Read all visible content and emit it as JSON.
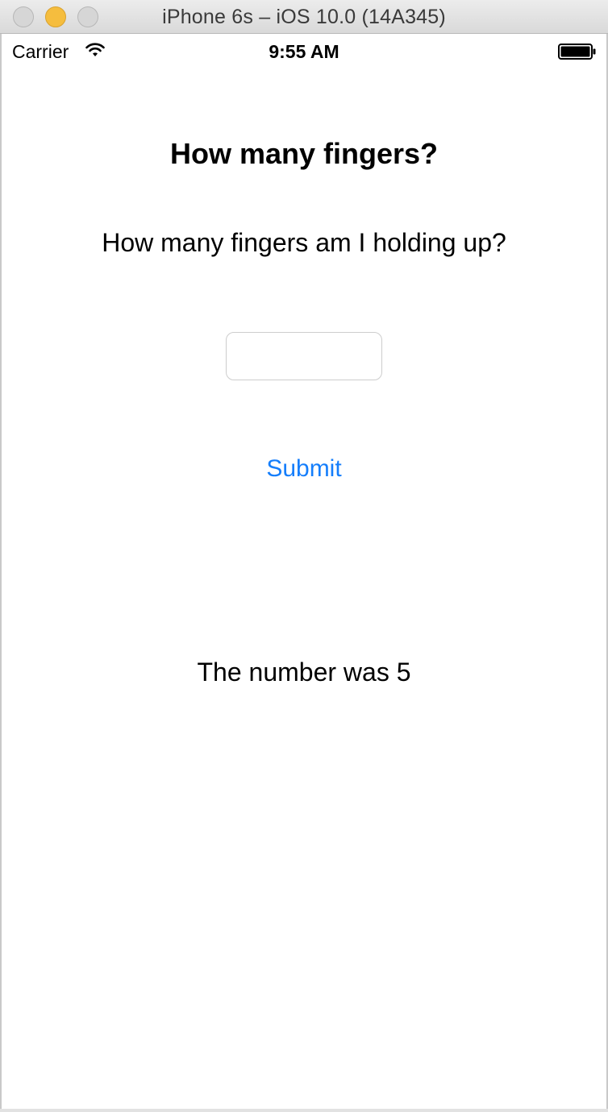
{
  "window": {
    "title": "iPhone 6s – iOS 10.0 (14A345)"
  },
  "status_bar": {
    "carrier": "Carrier",
    "time": "9:55 AM",
    "icons": [
      "wifi-icon",
      "battery-icon"
    ]
  },
  "app": {
    "heading": "How many fingers?",
    "question": "How many fingers am I holding up?",
    "answer_field": {
      "value": "",
      "placeholder": ""
    },
    "submit_label": "Submit",
    "result_text": "The number was 5"
  },
  "colors": {
    "accent": "#157efb",
    "minimize_button": "#f5bd3e",
    "text": "#000000"
  }
}
